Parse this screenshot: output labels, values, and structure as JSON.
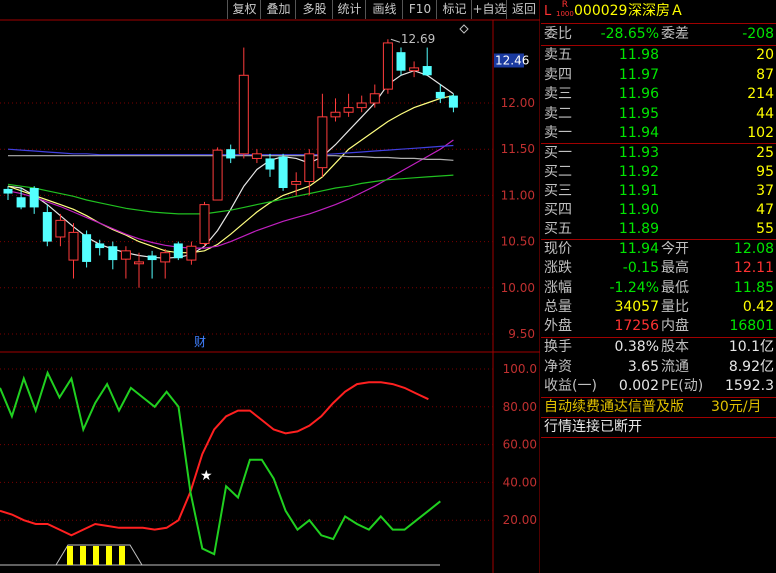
{
  "toolbar": {
    "items": [
      "复权",
      "叠加",
      "多股",
      "统计",
      "画线",
      "F10",
      "标记",
      "+自选",
      "返回"
    ]
  },
  "chart_data": [
    {
      "type": "candlestick",
      "ylim": [
        9.5,
        13.1
      ],
      "y_ticks": [
        "12.46",
        "12.00",
        "11.50",
        "11.00",
        "10.50",
        "10.00",
        "9.50"
      ],
      "current_price_label": "12.46",
      "max_label": "12.69",
      "marker_label": "财",
      "candles": [
        {
          "o": 11.07,
          "c": 11.02,
          "h": 11.1,
          "l": 10.95
        },
        {
          "o": 10.98,
          "c": 10.87,
          "h": 11.08,
          "l": 10.85
        },
        {
          "o": 11.08,
          "c": 10.87,
          "h": 11.1,
          "l": 10.8
        },
        {
          "o": 10.82,
          "c": 10.5,
          "h": 10.9,
          "l": 10.45
        },
        {
          "o": 10.55,
          "c": 10.73,
          "h": 10.8,
          "l": 10.45
        },
        {
          "o": 10.3,
          "c": 10.6,
          "h": 10.7,
          "l": 10.1
        },
        {
          "o": 10.58,
          "c": 10.28,
          "h": 10.62,
          "l": 10.22
        },
        {
          "o": 10.48,
          "c": 10.43,
          "h": 10.52,
          "l": 10.35
        },
        {
          "o": 10.45,
          "c": 10.3,
          "h": 10.5,
          "l": 10.2
        },
        {
          "o": 10.31,
          "c": 10.4,
          "h": 10.45,
          "l": 10.1
        },
        {
          "o": 10.26,
          "c": 10.28,
          "h": 10.38,
          "l": 10.0
        },
        {
          "o": 10.35,
          "c": 10.3,
          "h": 10.4,
          "l": 10.1
        },
        {
          "o": 10.28,
          "c": 10.38,
          "h": 10.42,
          "l": 10.1
        },
        {
          "o": 10.48,
          "c": 10.32,
          "h": 10.5,
          "l": 10.3
        },
        {
          "o": 10.3,
          "c": 10.45,
          "h": 10.5,
          "l": 10.25
        },
        {
          "o": 10.48,
          "c": 10.9,
          "h": 10.93,
          "l": 10.45
        },
        {
          "o": 10.95,
          "c": 11.49,
          "h": 11.52,
          "l": 10.95
        },
        {
          "o": 11.5,
          "c": 11.4,
          "h": 11.55,
          "l": 11.35
        },
        {
          "o": 11.45,
          "c": 12.3,
          "h": 12.6,
          "l": 11.4
        },
        {
          "o": 11.4,
          "c": 11.45,
          "h": 11.5,
          "l": 11.35
        },
        {
          "o": 11.4,
          "c": 11.28,
          "h": 11.45,
          "l": 11.2
        },
        {
          "o": 11.42,
          "c": 11.08,
          "h": 11.45,
          "l": 11.05
        },
        {
          "o": 11.12,
          "c": 11.15,
          "h": 11.25,
          "l": 11.0
        },
        {
          "o": 11.15,
          "c": 11.45,
          "h": 11.5,
          "l": 11.0
        },
        {
          "o": 11.3,
          "c": 11.85,
          "h": 12.1,
          "l": 11.2
        },
        {
          "o": 11.85,
          "c": 11.9,
          "h": 12.05,
          "l": 11.8
        },
        {
          "o": 11.9,
          "c": 11.95,
          "h": 12.1,
          "l": 11.85
        },
        {
          "o": 11.95,
          "c": 12.0,
          "h": 12.08,
          "l": 11.9
        },
        {
          "o": 12.0,
          "c": 12.1,
          "h": 12.2,
          "l": 11.95
        },
        {
          "o": 12.15,
          "c": 12.65,
          "h": 12.69,
          "l": 12.1
        },
        {
          "o": 12.55,
          "c": 12.35,
          "h": 12.6,
          "l": 12.3
        },
        {
          "o": 12.35,
          "c": 12.38,
          "h": 12.45,
          "l": 12.28
        },
        {
          "o": 12.4,
          "c": 12.3,
          "h": 12.6,
          "l": 12.3
        },
        {
          "o": 12.12,
          "c": 12.05,
          "h": 12.2,
          "l": 12.0
        },
        {
          "o": 12.08,
          "c": 11.95,
          "h": 12.1,
          "l": 11.9
        }
      ],
      "ma": [
        {
          "color": "#e6e6e6",
          "values": [
            11.1,
            11.08,
            11.0,
            10.9,
            10.78,
            10.66,
            10.55,
            10.47,
            10.42,
            10.38,
            10.35,
            10.33,
            10.32,
            10.33,
            10.36,
            10.45,
            10.62,
            10.85,
            11.1,
            11.28,
            11.38,
            11.42,
            11.4,
            11.35,
            11.42,
            11.55,
            11.7,
            11.85,
            12.0,
            12.2,
            12.3,
            12.35,
            12.3,
            12.2,
            12.1
          ]
        },
        {
          "color": "#ffff80",
          "values": [
            11.1,
            11.05,
            11.0,
            10.95,
            10.9,
            10.85,
            10.78,
            10.7,
            10.63,
            10.57,
            10.5,
            10.45,
            10.4,
            10.38,
            10.38,
            10.4,
            10.47,
            10.58,
            10.7,
            10.82,
            10.92,
            11.0,
            11.05,
            11.1,
            11.2,
            11.35,
            11.5,
            11.6,
            11.7,
            11.8,
            11.88,
            11.95,
            12.0,
            12.05,
            12.08
          ]
        },
        {
          "color": "#c020c0",
          "values": [
            11.05,
            11.02,
            10.98,
            10.93,
            10.88,
            10.82,
            10.76,
            10.7,
            10.64,
            10.58,
            10.53,
            10.49,
            10.46,
            10.44,
            10.43,
            10.43,
            10.45,
            10.5,
            10.56,
            10.62,
            10.67,
            10.72,
            10.76,
            10.8,
            10.85,
            10.9,
            10.96,
            11.03,
            11.1,
            11.18,
            11.26,
            11.34,
            11.42,
            11.5,
            11.6
          ]
        },
        {
          "color": "#20c020",
          "values": [
            11.12,
            11.1,
            11.08,
            11.05,
            11.02,
            10.99,
            10.95,
            10.92,
            10.89,
            10.86,
            10.84,
            10.82,
            10.81,
            10.8,
            10.8,
            10.8,
            10.82,
            10.84,
            10.87,
            10.9,
            10.93,
            10.96,
            10.99,
            11.02,
            11.05,
            11.08,
            11.1,
            11.13,
            11.15,
            11.17,
            11.18,
            11.19,
            11.2,
            11.21,
            11.22
          ]
        },
        {
          "color": "#4040e0",
          "values": [
            11.5,
            11.49,
            11.48,
            11.47,
            11.46,
            11.45,
            11.45,
            11.44,
            11.44,
            11.44,
            11.44,
            11.44,
            11.44,
            11.44,
            11.44,
            11.44,
            11.44,
            11.44,
            11.44,
            11.44,
            11.44,
            11.44,
            11.44,
            11.44,
            11.44,
            11.45,
            11.46,
            11.47,
            11.48,
            11.49,
            11.5,
            11.51,
            11.52,
            11.53,
            11.54
          ]
        },
        {
          "color": "#b0b0b0",
          "values": [
            11.43,
            11.43,
            11.43,
            11.43,
            11.43,
            11.43,
            11.43,
            11.43,
            11.43,
            11.43,
            11.43,
            11.43,
            11.43,
            11.43,
            11.43,
            11.43,
            11.43,
            11.43,
            11.43,
            11.43,
            11.43,
            11.43,
            11.43,
            11.43,
            11.43,
            11.43,
            11.42,
            11.42,
            11.41,
            11.41,
            11.4,
            11.4,
            11.39,
            11.39,
            11.38
          ]
        }
      ]
    },
    {
      "type": "line",
      "ylim": [
        0,
        110
      ],
      "y_ticks": [
        "100.0",
        "80.00",
        "60.00",
        "40.00",
        "20.00"
      ],
      "series": [
        {
          "color": "#ff2020",
          "values": [
            25,
            23,
            20,
            18,
            18,
            15,
            12,
            15,
            18,
            17,
            16,
            16,
            16,
            15,
            16,
            20,
            35,
            55,
            68,
            75,
            78,
            78,
            73,
            68,
            66,
            67,
            70,
            75,
            82,
            88,
            92,
            93,
            93,
            92,
            90,
            87,
            84
          ]
        },
        {
          "color": "#20d020",
          "values": [
            90,
            75,
            95,
            78,
            98,
            85,
            95,
            68,
            82,
            92,
            78,
            90,
            85,
            80,
            88,
            80,
            35,
            5,
            2,
            38,
            32,
            52,
            52,
            42,
            25,
            15,
            20,
            12,
            10,
            22,
            18,
            15,
            22,
            15,
            15,
            20,
            25,
            30
          ]
        }
      ],
      "star_label": "★"
    }
  ],
  "quote": {
    "header": {
      "prefix": "L",
      "badge_top": "R",
      "badge_bottom": "1000",
      "code": "000029",
      "name": "深深房Ａ"
    },
    "ratio": {
      "label": "委比",
      "value": "-28.65%",
      "label2": "委差",
      "value2": "-208"
    },
    "asks": [
      {
        "label": "卖五",
        "price": "11.98",
        "vol": "20"
      },
      {
        "label": "卖四",
        "price": "11.97",
        "vol": "87"
      },
      {
        "label": "卖三",
        "price": "11.96",
        "vol": "214"
      },
      {
        "label": "卖二",
        "price": "11.95",
        "vol": "44"
      },
      {
        "label": "卖一",
        "price": "11.94",
        "vol": "102"
      }
    ],
    "bids": [
      {
        "label": "买一",
        "price": "11.93",
        "vol": "25"
      },
      {
        "label": "买二",
        "price": "11.92",
        "vol": "95"
      },
      {
        "label": "买三",
        "price": "11.91",
        "vol": "37"
      },
      {
        "label": "买四",
        "price": "11.90",
        "vol": "47"
      },
      {
        "label": "买五",
        "price": "11.89",
        "vol": "55"
      }
    ],
    "stats": [
      {
        "l1": "现价",
        "v1": "11.94",
        "c1": "green",
        "l2": "今开",
        "v2": "12.08",
        "c2": "green"
      },
      {
        "l1": "涨跌",
        "v1": "-0.15",
        "c1": "green",
        "l2": "最高",
        "v2": "12.11",
        "c2": "red"
      },
      {
        "l1": "涨幅",
        "v1": "-1.24%",
        "c1": "green",
        "l2": "最低",
        "v2": "11.85",
        "c2": "green"
      },
      {
        "l1": "总量",
        "v1": "34057",
        "c1": "yellow",
        "l2": "量比",
        "v2": "0.42",
        "c2": "yellow"
      },
      {
        "l1": "外盘",
        "v1": "17256",
        "c1": "red",
        "l2": "内盘",
        "v2": "16801",
        "c2": "green"
      }
    ],
    "fundamentals": [
      {
        "l1": "换手",
        "v1": "0.38%",
        "l2": "股本",
        "v2": "10.1亿"
      },
      {
        "l1": "净资",
        "v1": "3.65",
        "l2": "流通",
        "v2": "8.92亿"
      },
      {
        "l1": "收益(一)",
        "v1": "0.002",
        "l2": "PE(动)",
        "v2": "1592.3"
      }
    ],
    "notice": {
      "text": "自动续费通达信普及版",
      "price": "30元/月"
    },
    "status": "行情连接已断开"
  }
}
